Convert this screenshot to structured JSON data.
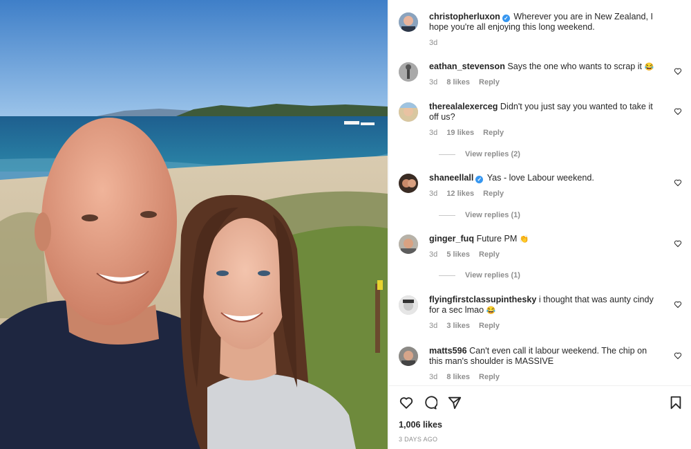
{
  "post": {
    "author": "christopherluxon",
    "author_verified": true,
    "caption": "Wherever you are in New Zealand, I hope you're all enjoying this long weekend.",
    "time": "3d",
    "likes": "1,006 likes",
    "date": "3 DAYS AGO"
  },
  "comments": [
    {
      "username": "eathan_stevenson",
      "text": "Says the one who wants to scrap it",
      "emoji": "😂",
      "time": "3d",
      "likes": "8 likes",
      "reply": "Reply"
    },
    {
      "username": "therealalexerceg",
      "text": "Didn't you just say you wanted to take it off us?",
      "time": "3d",
      "likes": "19 likes",
      "reply": "Reply",
      "view_replies": "View replies (2)"
    },
    {
      "username": "shaneellall",
      "verified": true,
      "text": "Yas - love Labour weekend.",
      "time": "3d",
      "likes": "12 likes",
      "reply": "Reply",
      "view_replies": "View replies (1)"
    },
    {
      "username": "ginger_fuq",
      "text": "Future PM",
      "emoji": "👏",
      "time": "3d",
      "likes": "5 likes",
      "reply": "Reply",
      "view_replies": "View replies (1)"
    },
    {
      "username": "flyingfirstclassupinthesky",
      "text": "i thought that was aunty cindy for a sec lmao",
      "emoji": "😂",
      "time": "3d",
      "likes": "3 likes",
      "reply": "Reply"
    },
    {
      "username": "matts596",
      "text": "Can't even call it labour weekend. The chip on this man's shoulder is MASSIVE",
      "time": "3d",
      "likes": "8 likes",
      "reply": "Reply"
    }
  ],
  "actions": {
    "like_icon": "heart-icon",
    "comment_icon": "comment-icon",
    "share_icon": "paper-plane-icon",
    "save_icon": "bookmark-icon"
  },
  "colors": {
    "verified_badge": "#3797f0",
    "muted_text": "#8e8e8e",
    "text": "#262626",
    "sky": "#4a90d9",
    "sea": "#1d6a96"
  }
}
